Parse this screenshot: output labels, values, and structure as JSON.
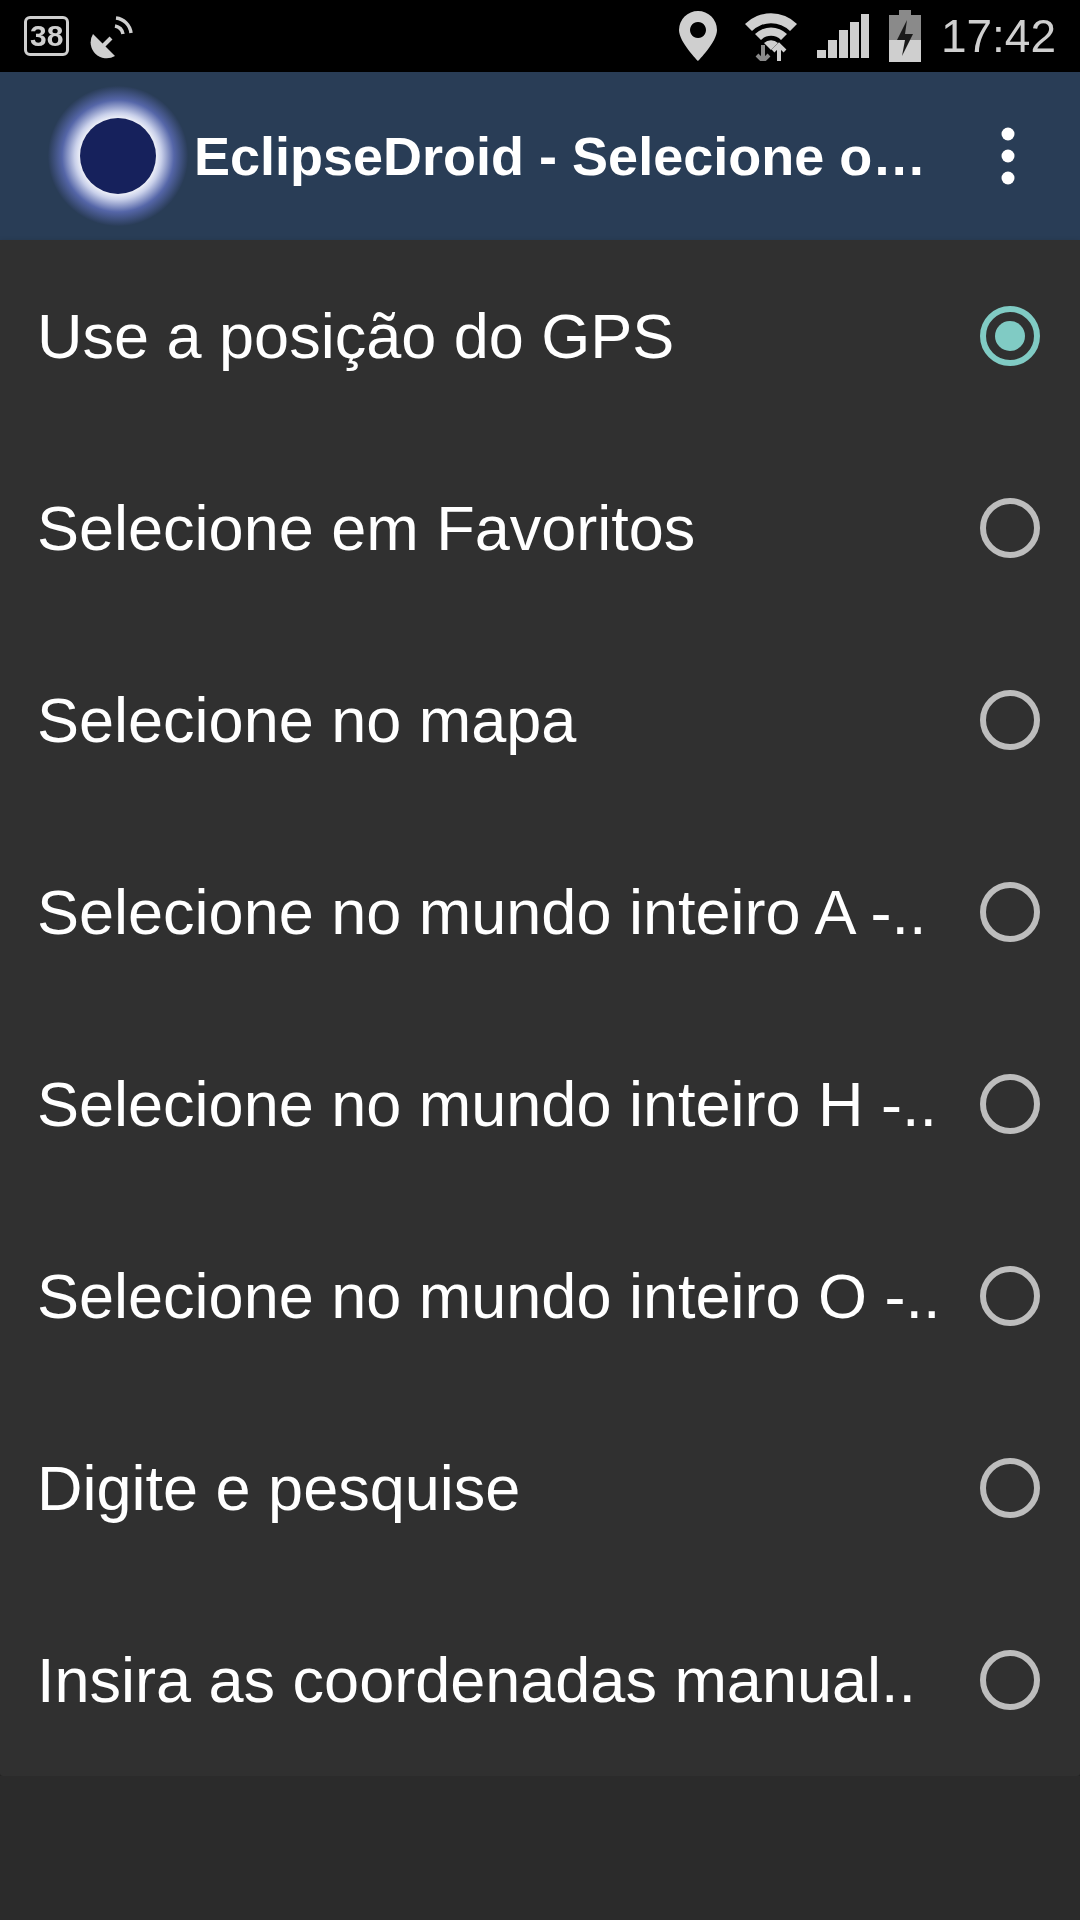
{
  "status_bar": {
    "notification_count": "38",
    "time": "17:42"
  },
  "app_bar": {
    "title": "EclipseDroid - Selecione o…"
  },
  "options": [
    {
      "label": "Use a posição do GPS",
      "selected": true
    },
    {
      "label": "Selecione em Favoritos",
      "selected": false
    },
    {
      "label": "Selecione no mapa",
      "selected": false
    },
    {
      "label": "Selecione no mundo inteiro A -..",
      "selected": false
    },
    {
      "label": "Selecione no mundo inteiro H -..",
      "selected": false
    },
    {
      "label": "Selecione no mundo inteiro O -..",
      "selected": false
    },
    {
      "label": "Digite e pesquise",
      "selected": false
    },
    {
      "label": "Insira as coordenadas manual..",
      "selected": false
    }
  ]
}
